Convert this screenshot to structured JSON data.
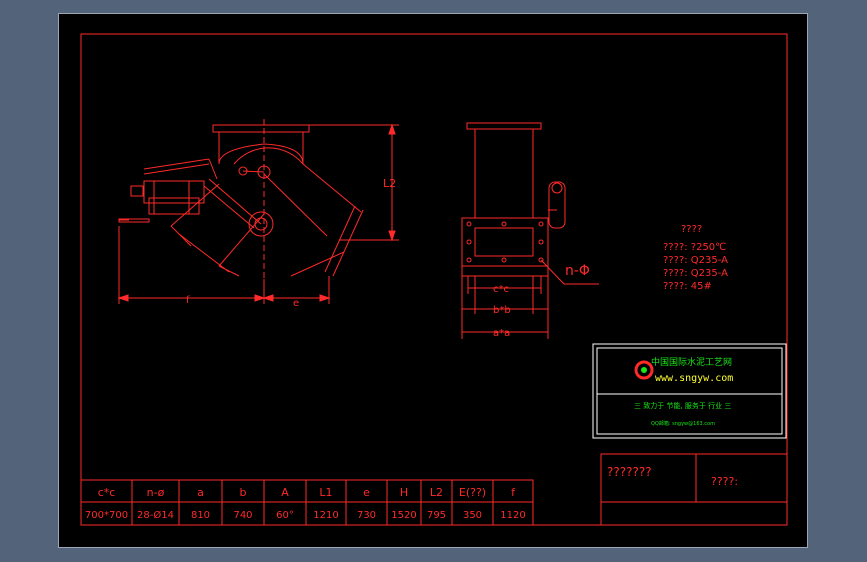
{
  "notes": {
    "title": "????",
    "lines": [
      "????: ?250℃",
      "????: Q235-A",
      "????: Q235-A",
      "????: 45#"
    ]
  },
  "labels": {
    "L2": "L2",
    "f": "f",
    "e": "e",
    "n_phi": "n-Φ",
    "cxc": "c*c",
    "bxb": "b*b",
    "axa": "a*a"
  },
  "logo": {
    "name": "中国国际水泥工艺网",
    "url": "www.sngyw.com",
    "line1": "三 致力于 节能, 服务于 行业 三",
    "line2": "QQ邮箱: sngyw@163.com"
  },
  "title_block": {
    "left": "???????",
    "right": "????:"
  },
  "spec_table": {
    "headers": [
      "c*c",
      "n-ø",
      "a",
      "b",
      "A",
      "L1",
      "e",
      "H",
      "L2",
      "E(??)",
      "f"
    ],
    "values": [
      "700*700",
      "28-Ø14",
      "810",
      "740",
      "60°",
      "1210",
      "730",
      "1520",
      "795",
      "350",
      "1120"
    ]
  },
  "colors": {
    "line": "#ff2a2a",
    "sheet": "#000000",
    "bezel": "#52637a",
    "frame": "#ffffff",
    "logo_green": "#19e619"
  }
}
